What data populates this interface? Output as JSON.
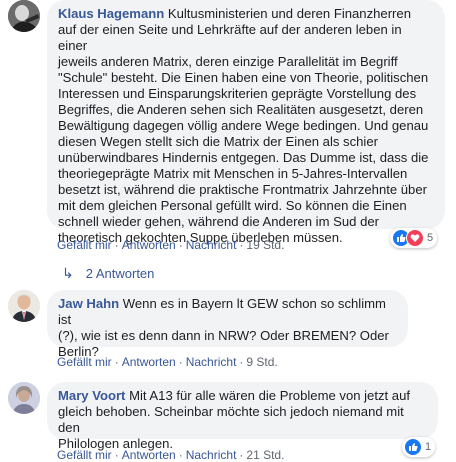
{
  "comments": [
    {
      "author": "Klaus Hagemann",
      "lines": [
        "Kultusministerien und deren Finanzherren",
        "auf der einen Seite und Lehrkräfte auf der anderen leben in einer",
        "jeweils anderen Matrix, deren einzige Parallelität im Begriff",
        "\"Schule\" besteht. Die Einen haben eine von Theorie, politischen",
        "Interessen und Einsparungskriterien geprägte Vorstellung des",
        "Begriffes, die Anderen sehen sich Realitäten ausgesetzt, deren",
        "Bewältigung dagegen völlig andere Wege bedingen. Und genau",
        "diesen Wegen stellt sich die Matrix der Einen als schier",
        "unüberwindbares Hindernis entgegen. Das Dumme ist, dass die",
        "theoriegeprägte Matrix mit Menschen in 5-Jahres-Intervallen",
        "besetzt ist, während die praktische Frontmatrix Jahrzehnte über",
        "mit dem gleichen Personal gefüllt wird. So können die Einen",
        "schnell wieder gehen, während die Anderen im Sud der",
        "theoretisch gekochten Suppe überleben müssen."
      ],
      "actions": {
        "like": "Gefällt mir",
        "reply": "Antworten",
        "message": "Nachricht",
        "time": "19 Std."
      },
      "reactions": {
        "count": "5",
        "types": [
          "like-icon",
          "love-icon"
        ]
      }
    },
    {
      "author": "Jaw Hahn",
      "lines": [
        "Wenn es in Bayern lt GEW schon so schlimm ist",
        "(?), wie ist es denn dann in NRW? Oder BREMEN? Oder",
        "Berlin?"
      ],
      "actions": {
        "like": "Gefällt mir",
        "reply": "Antworten",
        "message": "Nachricht",
        "time": "9 Std."
      }
    },
    {
      "author": "Mary Voort",
      "lines": [
        "Mit A13 für alle wären die Probleme von jetzt auf",
        "gleich behoben. Scheinbar möchte sich jedoch niemand mit den",
        "Philologen anlegen."
      ],
      "actions": {
        "like": "Gefällt mir",
        "reply": "Antworten",
        "message": "Nachricht",
        "time": "21 Std."
      },
      "reactions": {
        "count": "1",
        "types": [
          "like-icon"
        ]
      }
    }
  ],
  "replies_toggle": {
    "label": "2 Antworten",
    "icon": "reply-arrow-icon"
  },
  "colors": {
    "link": "#385898",
    "bubble": "#f2f3f5",
    "meta": "#606770",
    "like": "#1877f2",
    "love": "#f33e58"
  }
}
